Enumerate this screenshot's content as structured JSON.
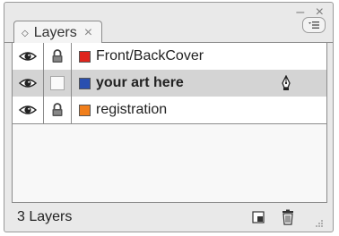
{
  "panel": {
    "tab_label": "Layers",
    "tab_icon": "expand-diamond-icon",
    "close_glyph": "×",
    "window_controls": "– ×"
  },
  "layers": [
    {
      "name": "Front/BackCover",
      "color": "#e0241c",
      "visible": true,
      "locked": true,
      "selected": false
    },
    {
      "name": "your art here",
      "color": "#2a4fb0",
      "visible": true,
      "locked": false,
      "selected": true,
      "active_pen": true
    },
    {
      "name": "registration",
      "color": "#f07e1b",
      "visible": true,
      "locked": true,
      "selected": false
    }
  ],
  "footer": {
    "count_label": "3 Layers"
  }
}
